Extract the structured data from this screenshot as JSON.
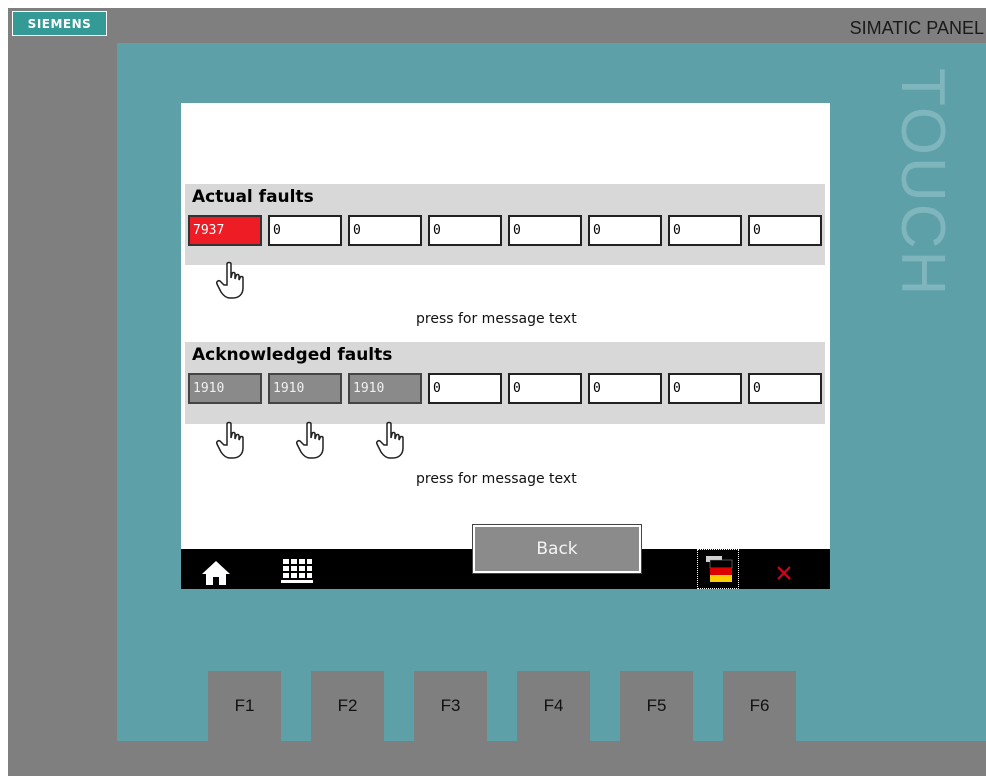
{
  "device": {
    "brand": "SIEMENS",
    "model": "SIMATIC PANEL",
    "vertical_word": "TOUCH"
  },
  "screen": {
    "actual_faults": {
      "title": "Actual faults",
      "boxes": [
        "7937",
        "0",
        "0",
        "0",
        "0",
        "0",
        "0",
        "0"
      ],
      "hint": "press for message text"
    },
    "acknowledged_faults": {
      "title": "Acknowledged faults",
      "boxes": [
        "1910",
        "1910",
        "1910",
        "0",
        "0",
        "0",
        "0",
        "0"
      ],
      "hint": "press for message text"
    },
    "back_label": "Back"
  },
  "taskbar": {
    "icons": [
      "home-icon",
      "keyboard-icon",
      "language-flag-icon",
      "close-icon"
    ]
  },
  "function_keys": [
    "F1",
    "F2",
    "F3",
    "F4",
    "F5",
    "F6"
  ],
  "colors": {
    "active_fault": "#ee1c24",
    "acknowledged_fault": "#8a8a8a",
    "bezel": "#5ea0a8",
    "frame": "#7f7f7f",
    "close": "#e0001b"
  }
}
